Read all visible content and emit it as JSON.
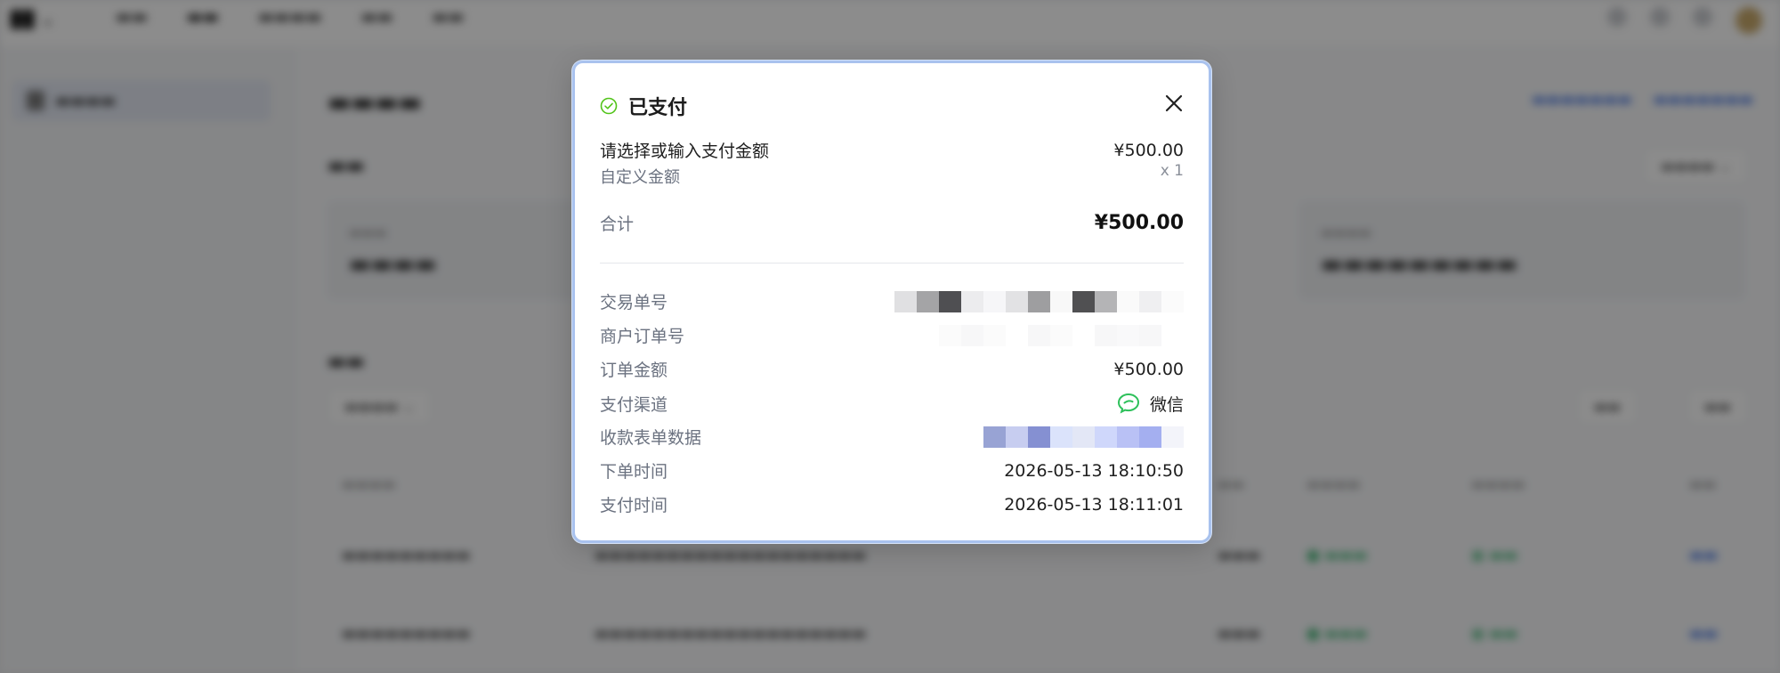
{
  "modal": {
    "title": "已支付",
    "amount_prompt": "请选择或输入支付金额",
    "amount_value": "¥500.00",
    "custom_amount_label": "自定义金额",
    "quantity": "x 1",
    "total_label": "合计",
    "total_value": "¥500.00",
    "details": {
      "transaction_no_label": "交易单号",
      "merchant_order_no_label": "商户订单号",
      "order_amount_label": "订单金额",
      "order_amount_value": "¥500.00",
      "pay_channel_label": "支付渠道",
      "pay_channel_value": "微信",
      "form_data_label": "收款表单数据",
      "order_time_label": "下单时间",
      "order_time_value": "2026-05-13 18:10:50",
      "pay_time_label": "支付时间",
      "pay_time_value": "2026-05-13 18:11:01"
    },
    "colors": {
      "success_green": "#52c41a",
      "wechat_green": "#2dc05a",
      "modal_border": "#a9c2ee"
    },
    "icons": {
      "status": "check-circle-icon",
      "close": "close-icon",
      "channel": "wechat-icon"
    }
  }
}
